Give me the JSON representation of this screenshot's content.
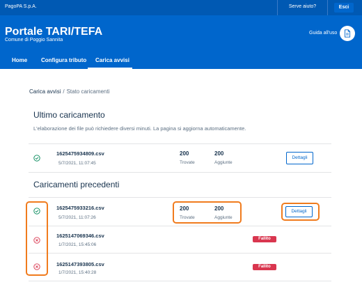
{
  "topbar": {
    "org": "PagoPA S.p.A.",
    "help": "Serve aiuto?",
    "logout": "Esci"
  },
  "header": {
    "title": "Portale TARI/TEFA",
    "subtitle": "Comune di Poggio Sannita",
    "guide": "Guida all'uso"
  },
  "nav": {
    "items": [
      "Home",
      "Configura tributo",
      "Carica avvisi"
    ],
    "active": "Carica avvisi"
  },
  "breadcrumb": {
    "parent": "Carica avvisi",
    "separator": "/",
    "current": "Stato caricamenti"
  },
  "last_upload": {
    "title": "Ultimo caricamento",
    "description": "L'elaborazione dei file può richiedere diversi minuti. La pagina si aggiorna automaticamente.",
    "file": {
      "name": "1625475934809.csv",
      "date": "5/7/2021, 11:07:45",
      "found": "200",
      "found_label": "Trovate",
      "added": "200",
      "added_label": "Aggiunte",
      "button": "Dettagli",
      "status": "success"
    }
  },
  "previous_uploads": {
    "title": "Caricamenti precedenti",
    "items": [
      {
        "name": "1625475933216.csv",
        "date": "5/7/2021, 11:07:26",
        "found": "200",
        "found_label": "Trovate",
        "added": "200",
        "added_label": "Aggiunte",
        "button": "Dettagli",
        "status": "success"
      },
      {
        "name": "1625147069346.csv",
        "date": "1/7/2021, 15:45:06",
        "badge": "Fallito",
        "status": "failed"
      },
      {
        "name": "1625147393805.csv",
        "date": "1/7/2021, 15:40:28",
        "badge": "Fallito",
        "status": "failed"
      }
    ]
  },
  "colors": {
    "primary": "#0066cc",
    "topbar": "#0059b3",
    "success": "#008758",
    "error": "#d9364f",
    "highlight": "#f07b1d"
  }
}
